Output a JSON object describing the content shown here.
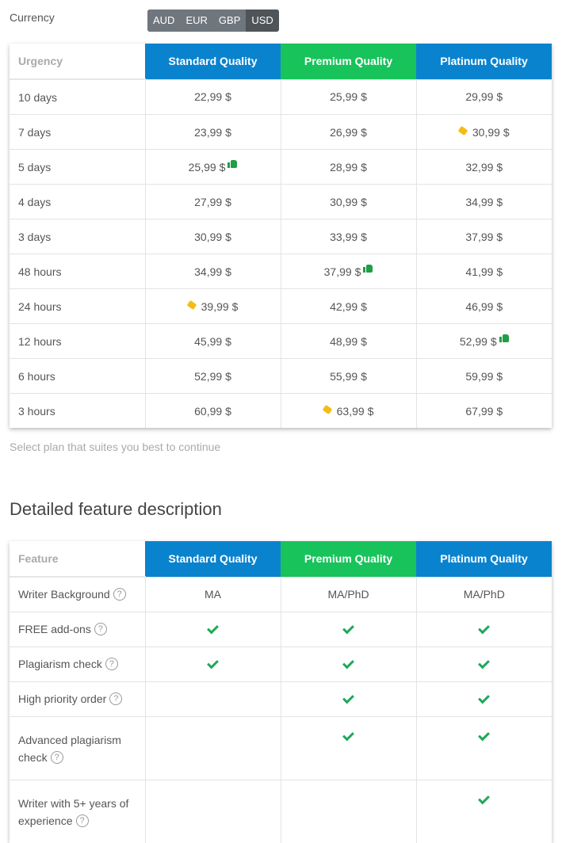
{
  "currency": {
    "label": "Currency",
    "options": [
      "AUD",
      "EUR",
      "GBP",
      "USD"
    ],
    "selected": "USD"
  },
  "pricing": {
    "headers": [
      "Urgency",
      "Standard Quality",
      "Premium Quality",
      "Platinum Quality"
    ],
    "rows": [
      {
        "urgency": "10 days",
        "prices": [
          "22,99 $",
          "25,99 $",
          "29,99 $"
        ]
      },
      {
        "urgency": "7 days",
        "prices": [
          "23,99 $",
          "26,99 $",
          "30,99 $"
        ]
      },
      {
        "urgency": "5 days",
        "prices": [
          "25,99 $",
          "28,99 $",
          "32,99 $"
        ]
      },
      {
        "urgency": "4 days",
        "prices": [
          "27,99 $",
          "30,99 $",
          "34,99 $"
        ]
      },
      {
        "urgency": "3 days",
        "prices": [
          "30,99 $",
          "33,99 $",
          "37,99 $"
        ]
      },
      {
        "urgency": "48 hours",
        "prices": [
          "34,99 $",
          "37,99 $",
          "41,99 $"
        ]
      },
      {
        "urgency": "24 hours",
        "prices": [
          "39,99 $",
          "42,99 $",
          "46,99 $"
        ]
      },
      {
        "urgency": "12 hours",
        "prices": [
          "45,99 $",
          "48,99 $",
          "52,99 $"
        ]
      },
      {
        "urgency": "6 hours",
        "prices": [
          "52,99 $",
          "55,99 $",
          "59,99 $"
        ]
      },
      {
        "urgency": "3 hours",
        "prices": [
          "60,99 $",
          "63,99 $",
          "67,99 $"
        ]
      }
    ],
    "hint": "Select plan that suites you best to continue"
  },
  "features": {
    "title": "Detailed feature description",
    "headers": [
      "Feature",
      "Standard Quality",
      "Premium Quality",
      "Platinum Quality"
    ],
    "rows": [
      {
        "name": "Writer Background",
        "values": [
          "MA",
          "MA/PhD",
          "MA/PhD"
        ]
      },
      {
        "name": "FREE add-ons",
        "values": [
          true,
          true,
          true
        ]
      },
      {
        "name": "Plagiarism check",
        "values": [
          true,
          true,
          true
        ]
      },
      {
        "name": "High priority order",
        "values": [
          false,
          true,
          true
        ]
      },
      {
        "name": "Advanced plagiarism check",
        "values": [
          false,
          true,
          true
        ]
      },
      {
        "name": "Writer with 5+ years of experience",
        "values": [
          false,
          false,
          true
        ]
      }
    ]
  },
  "colors": {
    "standard_header": "#0a83cf",
    "premium_header": "#17c35a",
    "platinum_header": "#0a83cf",
    "tag_icon": "#f3bd17",
    "thumb_icon": "#1e9e45",
    "check_icon": "#1fa85a"
  },
  "icons": {
    "tag": "price-tag-icon",
    "thumb": "thumbs-up-icon",
    "check": "check-icon",
    "help": "question-circle-icon"
  }
}
